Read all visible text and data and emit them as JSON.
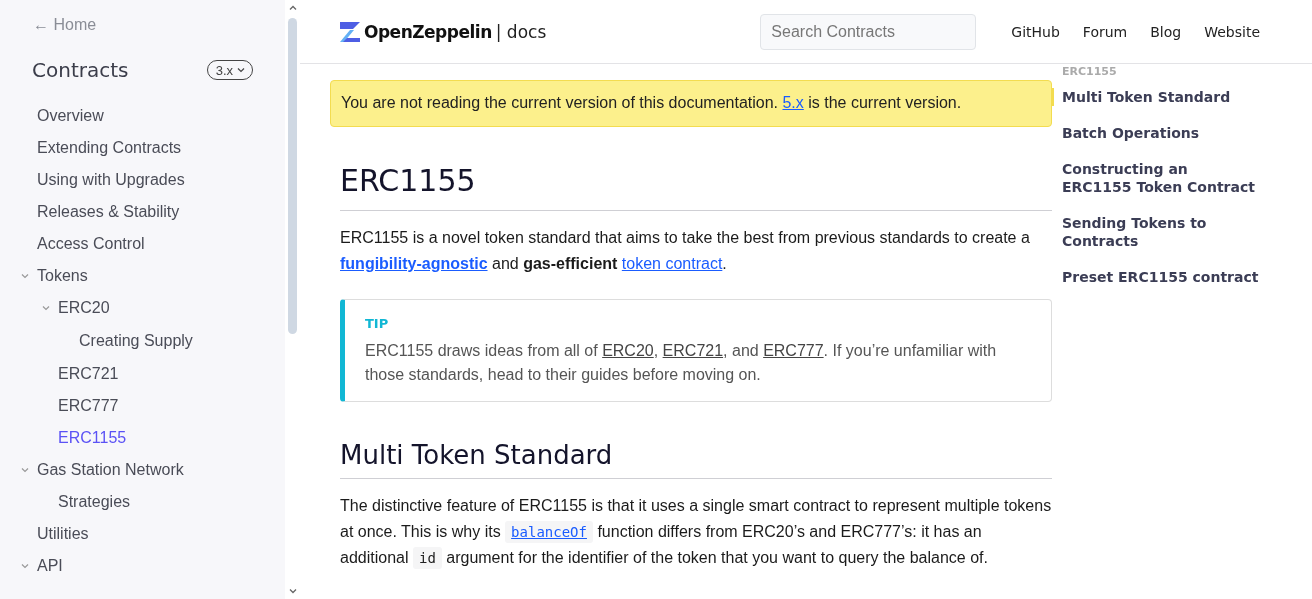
{
  "sidebar": {
    "home_link": "← Home",
    "title": "Contracts",
    "version": "3.x",
    "items": [
      {
        "label": "Overview",
        "selected": false
      },
      {
        "label": "Extending Contracts",
        "selected": false
      },
      {
        "label": "Using with Upgrades",
        "selected": false
      },
      {
        "label": "Releases & Stability",
        "selected": false
      },
      {
        "label": "Access Control",
        "selected": false
      },
      {
        "label": "Tokens",
        "selected": false,
        "expanded": true,
        "children": [
          {
            "label": "ERC20",
            "selected": false,
            "expanded": true,
            "children": [
              {
                "label": "Creating Supply",
                "selected": false
              }
            ]
          },
          {
            "label": "ERC721",
            "selected": false
          },
          {
            "label": "ERC777",
            "selected": false
          },
          {
            "label": "ERC1155",
            "selected": true
          }
        ]
      },
      {
        "label": "Gas Station Network",
        "selected": false,
        "expanded": true,
        "children": [
          {
            "label": "Strategies",
            "selected": false
          }
        ]
      },
      {
        "label": "Utilities",
        "selected": false
      },
      {
        "label": "API",
        "selected": false,
        "expanded": true
      }
    ]
  },
  "header": {
    "logo": "OpenZeppelin",
    "logo_suffix": "| docs",
    "search": {
      "placeholder": "Search Contracts"
    },
    "links": [
      "GitHub",
      "Forum",
      "Blog",
      "Website"
    ]
  },
  "notice": [
    {
      "kind": "text",
      "text": "You are not reading the current version of this documentation. "
    },
    {
      "kind": "link",
      "text": "5.x"
    },
    {
      "kind": "text",
      "text": " is the current version."
    }
  ],
  "article": {
    "title": "ERC1155",
    "intro": [
      {
        "kind": "text",
        "text": "ERC1155 is a novel token standard that aims to take the best from previous standards to create a "
      },
      {
        "kind": "strong-link",
        "text": "fungibility-agnostic"
      },
      {
        "kind": "text",
        "text": " and "
      },
      {
        "kind": "bold",
        "text": "gas-efficient "
      },
      {
        "kind": "link",
        "text": "token contract"
      },
      {
        "kind": "text",
        "text": "."
      }
    ],
    "tip": {
      "label": "TIP",
      "text": [
        {
          "kind": "text",
          "text": "ERC1155 draws ideas from all of "
        },
        {
          "kind": "plain-link",
          "text": "ERC20"
        },
        {
          "kind": "text",
          "text": ", "
        },
        {
          "kind": "plain-link",
          "text": "ERC721"
        },
        {
          "kind": "text",
          "text": ", and "
        },
        {
          "kind": "plain-link",
          "text": "ERC777"
        },
        {
          "kind": "text",
          "text": ". If you’re unfamiliar with those standards, head to their guides before moving on."
        }
      ]
    },
    "section_title": "Multi Token Standard",
    "section_text": [
      {
        "kind": "text",
        "text": "The distinctive feature of ERC1155 is that it uses a single smart contract to represent multiple tokens at once. This is why its "
      },
      {
        "kind": "code-link",
        "text": "balanceOf"
      },
      {
        "kind": "text",
        "text": " function differs from ERC20’s and ERC777’s: it has an additional "
      },
      {
        "kind": "code",
        "text": "id"
      },
      {
        "kind": "text",
        "text": " argument for the identifier of the token that you want to query the balance of."
      }
    ]
  },
  "toc": {
    "heading": "ERC1155",
    "items": [
      {
        "label": "Multi Token Standard",
        "selected": true
      },
      {
        "label": "Batch Operations",
        "selected": false
      },
      {
        "label": "Constructing an ERC1155 Token Contract",
        "selected": false
      },
      {
        "label": "Sending Tokens to Contracts",
        "selected": false
      },
      {
        "label": "Preset ERC1155 contract",
        "selected": false
      }
    ]
  }
}
